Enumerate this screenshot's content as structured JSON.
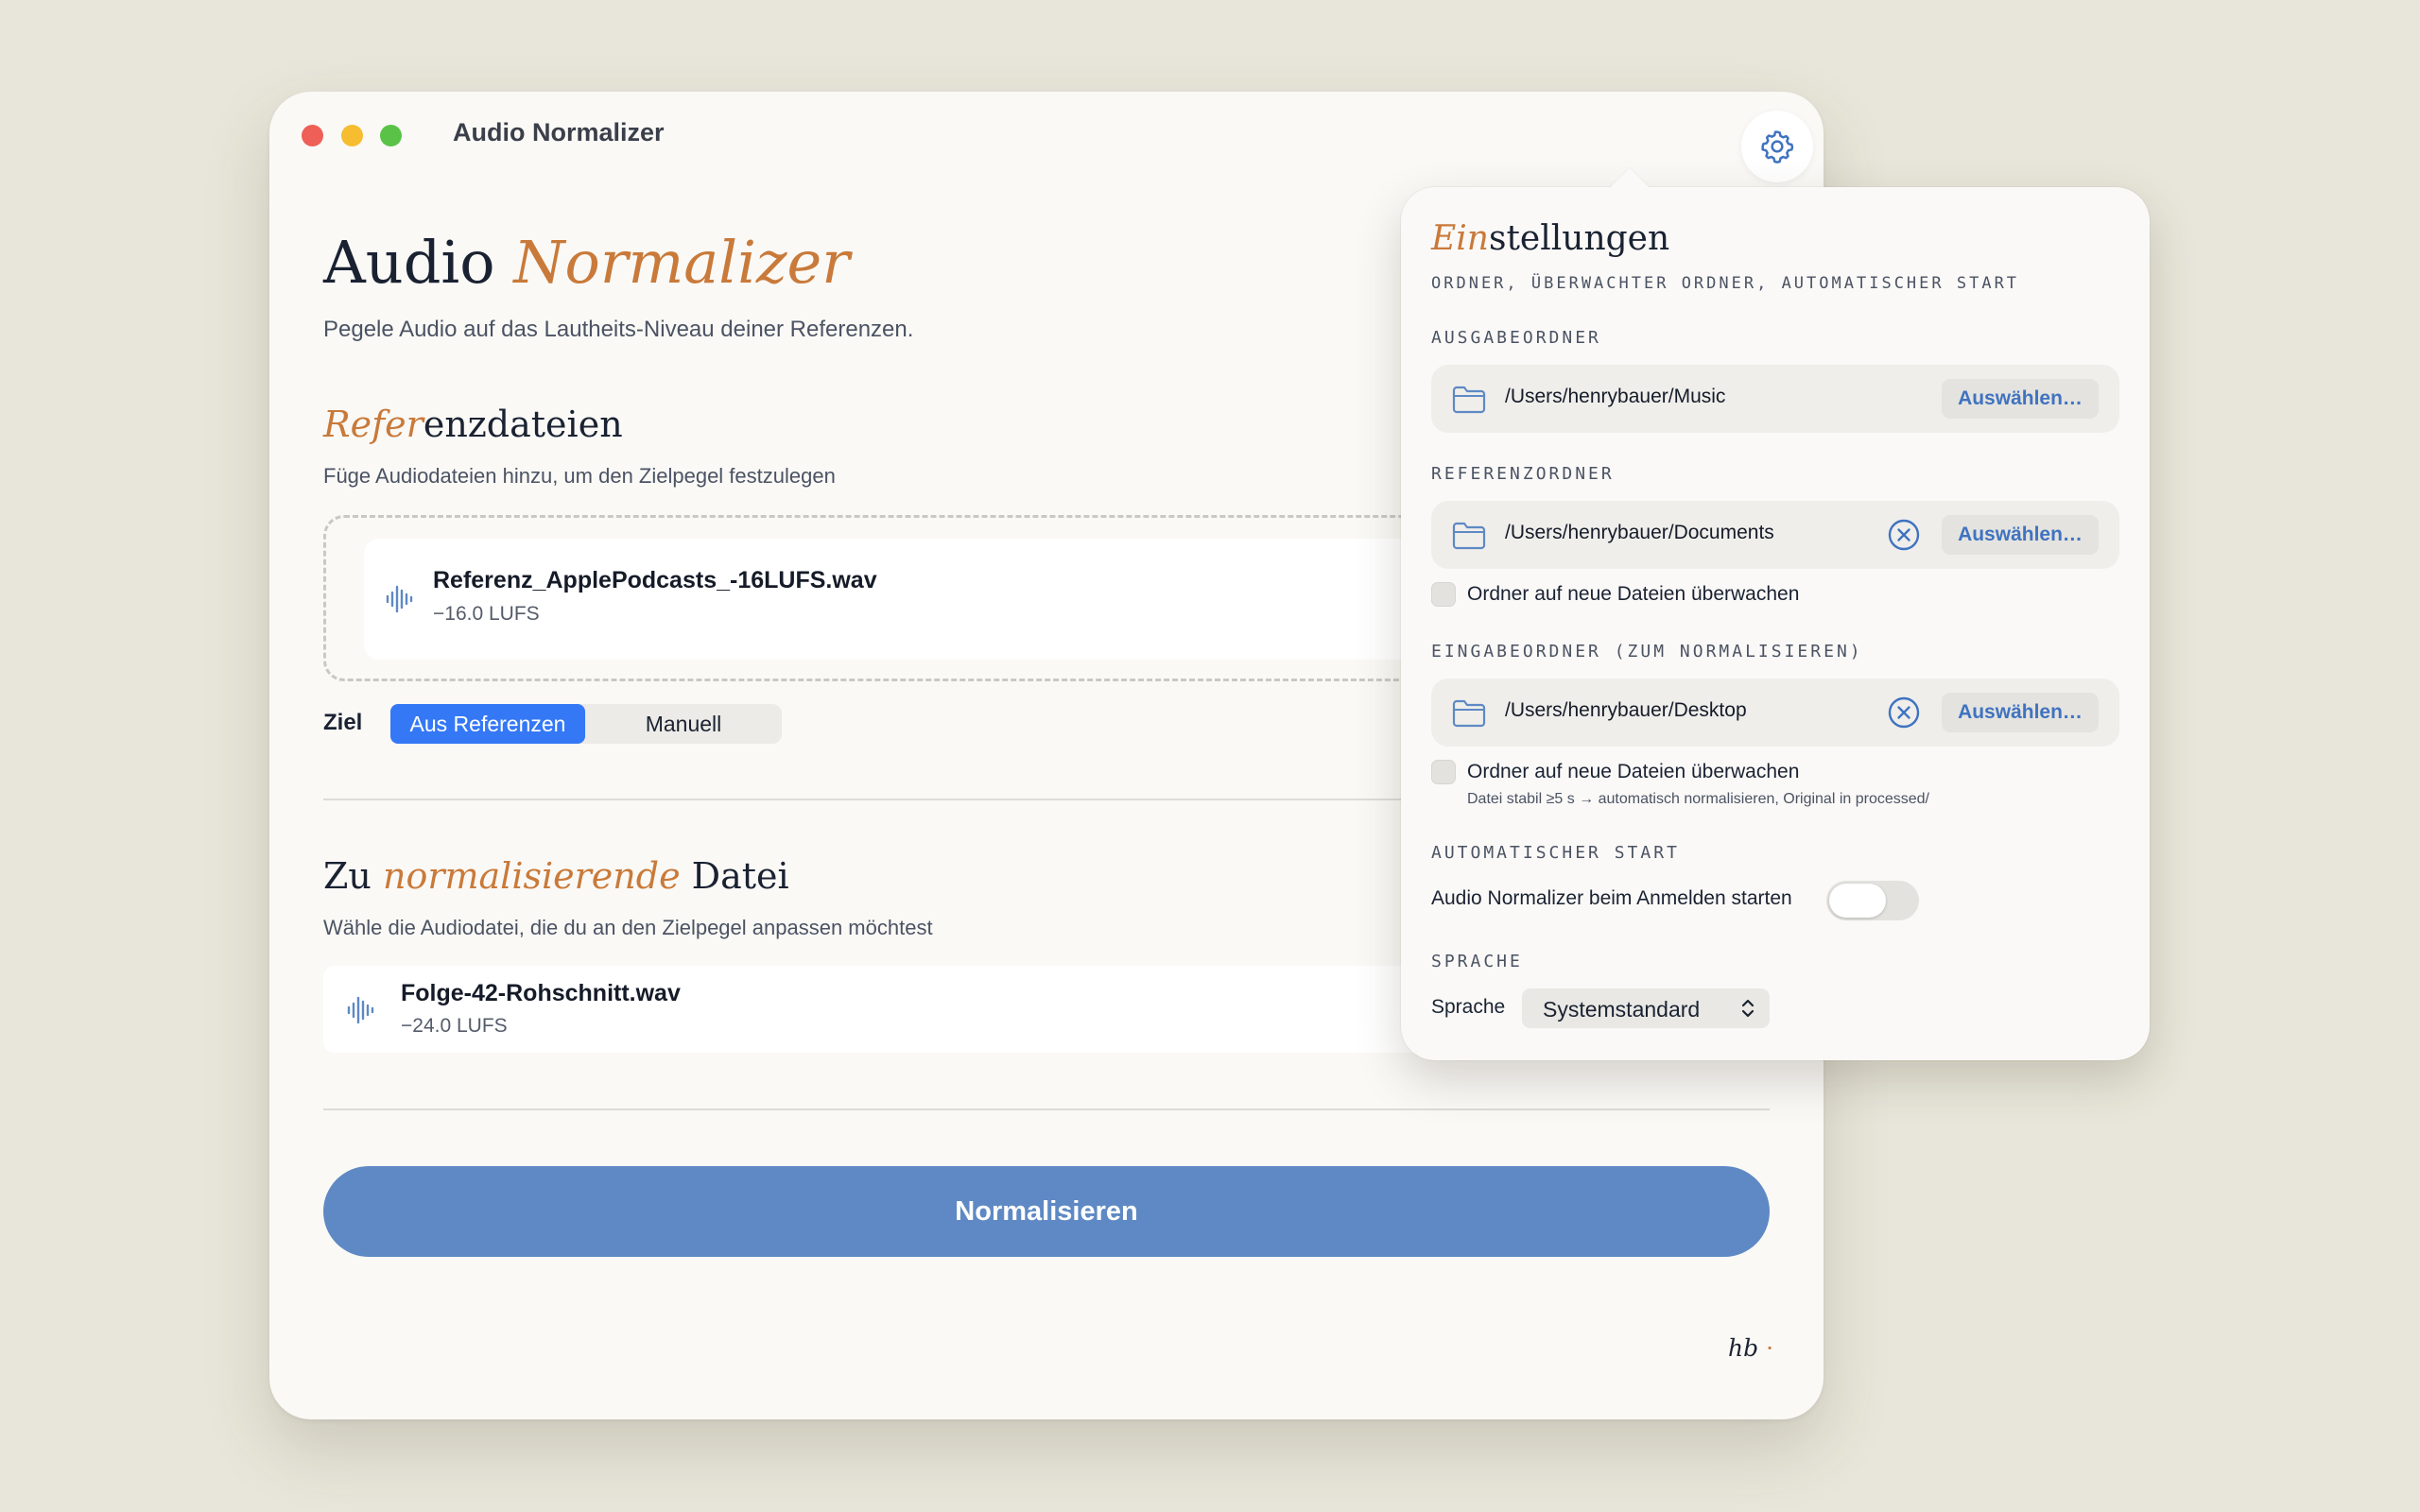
{
  "window": {
    "title": "Audio Normalizer"
  },
  "hero": {
    "title_plain": "Audio ",
    "title_accent": "Normalizer",
    "subtitle": "Pegele Audio auf das Lautheits-Niveau deiner Referenzen."
  },
  "reference_section": {
    "title_accent": "Refer",
    "title_plain": "enzdateien",
    "subtitle": "Füge Audiodateien hinzu, um den Zielpegel festzulegen",
    "file": {
      "name": "Referenz_ApplePodcasts_-16LUFS.wav",
      "loudness": "−16.0 LUFS"
    }
  },
  "target": {
    "label": "Ziel",
    "options": [
      "Aus Referenzen",
      "Manuell"
    ],
    "selected": "Aus Referenzen"
  },
  "normalize_section": {
    "title_a": "Zu ",
    "title_accent": "normalisierende",
    "title_b": " Datei",
    "subtitle": "Wähle die Audiodatei, die du an den Zielpegel anpassen möchtest",
    "file": {
      "name": "Folge-42-Rohschnitt.wav",
      "loudness": "−24.0 LUFS"
    }
  },
  "normalize_button": "Normalisieren",
  "signature": {
    "text": "hb",
    "dot": "·"
  },
  "settings": {
    "title_accent": "Ein",
    "title_plain": "stellungen",
    "subtitle": "ORDNER, ÜBERWACHTER ORDNER, AUTOMATISCHER START",
    "output_folder": {
      "label": "AUSGABEORDNER",
      "path": "/Users/henrybauer/Music",
      "choose": "Auswählen…"
    },
    "reference_folder": {
      "label": "REFERENZORDNER",
      "path": "/Users/henrybauer/Documents",
      "choose": "Auswählen…",
      "watch_label": "Ordner auf neue Dateien überwachen",
      "watch_checked": false
    },
    "input_folder": {
      "label": "EINGABEORDNER (ZUM NORMALISIEREN)",
      "path": "/Users/henrybauer/Desktop",
      "choose": "Auswählen…",
      "watch_label": "Ordner auf neue Dateien überwachen",
      "watch_checked": false,
      "hint": "Datei stabil ≥5 s → automatisch normalisieren, Original in processed/"
    },
    "autostart": {
      "label": "AUTOMATISCHER START",
      "toggle_label": "Audio Normalizer beim Anmelden starten",
      "enabled": false
    },
    "language": {
      "label": "SPRACHE",
      "field_label": "Sprache",
      "value": "Systemstandard"
    }
  },
  "colors": {
    "background": "#e8e6da",
    "accent_orange": "#c97a3a",
    "accent_blue": "#3478f6",
    "button_blue": "#5e89c4",
    "link_blue": "#3f73c0"
  }
}
